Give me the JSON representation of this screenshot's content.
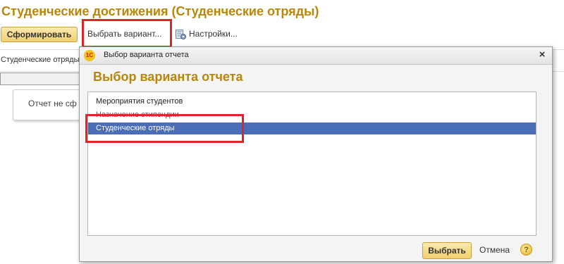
{
  "page": {
    "title": "Студенческие достижения (Студенческие отряды)"
  },
  "toolbar": {
    "generate_label": "Сформировать",
    "choose_variant_label": "Выбрать вариант...",
    "settings_label": "Настройки..."
  },
  "background": {
    "tab_label": "Студенческие отряды",
    "report_status_text": "Отчет не сф"
  },
  "dialog": {
    "titlebar_text": "Выбор варианта отчета",
    "logo_text": "1С",
    "heading": "Выбор варианта отчета",
    "variants": [
      {
        "label": "Мероприятия студентов",
        "selected": false
      },
      {
        "label": "Назначение стипендии",
        "selected": false
      },
      {
        "label": "Студенческие отряды",
        "selected": true
      }
    ],
    "choose_button": "Выбрать",
    "cancel_button": "Отмена",
    "help_glyph": "?",
    "close_glyph": "×"
  },
  "colors": {
    "accent": "#b8860b",
    "selection": "#4b6cb7",
    "highlight": "#e0252a"
  }
}
